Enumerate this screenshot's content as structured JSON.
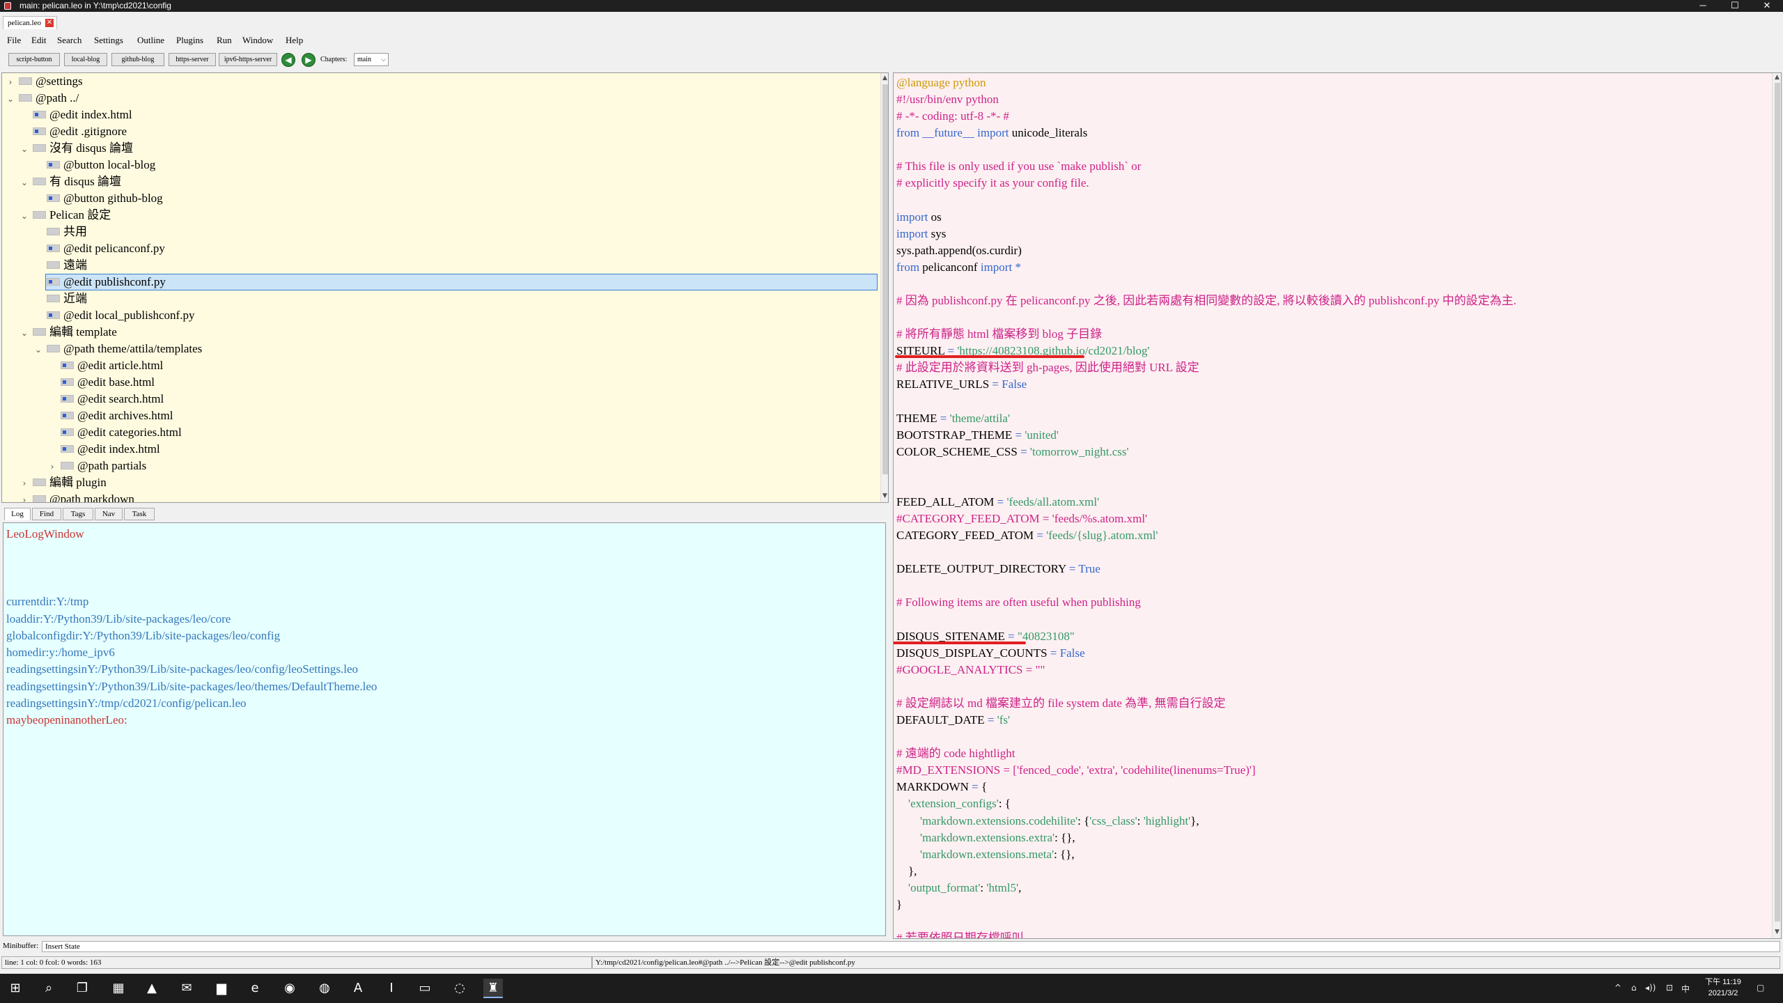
{
  "window": {
    "title": "main: pelican.leo in Y:\\tmp\\cd2021\\config",
    "minimize": "─",
    "maximize": "☐",
    "close": "✕"
  },
  "tab": {
    "name": "pelican.leo",
    "close": "✕"
  },
  "menu": [
    "File",
    "Edit",
    "Search",
    "Settings",
    "Outline",
    "Plugins",
    "Run",
    "Window",
    "Help"
  ],
  "toolbar": {
    "buttons": [
      "script-button",
      "local-blog",
      "github-blog",
      "https-server",
      "ipv6-https-server"
    ],
    "back": "◀",
    "forward": "▶",
    "chapters_label": "Chapters:",
    "chapters_value": "main",
    "dropdown": "⌵"
  },
  "outline": {
    "nodes": [
      {
        "depth": 0,
        "twisty": "›",
        "icon": "plain",
        "label": "@settings"
      },
      {
        "depth": 0,
        "twisty": "⌄",
        "icon": "plain",
        "label": "@path ../"
      },
      {
        "depth": 1,
        "twisty": "",
        "icon": "body",
        "label": "@edit index.html"
      },
      {
        "depth": 1,
        "twisty": "",
        "icon": "body",
        "label": "@edit .gitignore"
      },
      {
        "depth": 1,
        "twisty": "⌄",
        "icon": "plain",
        "label": "沒有 disqus 論壇"
      },
      {
        "depth": 2,
        "twisty": "",
        "icon": "body",
        "label": "@button local-blog"
      },
      {
        "depth": 1,
        "twisty": "⌄",
        "icon": "plain",
        "label": "有 disqus 論壇"
      },
      {
        "depth": 2,
        "twisty": "",
        "icon": "body",
        "label": "@button github-blog"
      },
      {
        "depth": 1,
        "twisty": "⌄",
        "icon": "plain",
        "label": "Pelican 設定"
      },
      {
        "depth": 2,
        "twisty": "",
        "icon": "plain",
        "label": "共用"
      },
      {
        "depth": 2,
        "twisty": "",
        "icon": "body",
        "label": "@edit pelicanconf.py"
      },
      {
        "depth": 2,
        "twisty": "",
        "icon": "plain",
        "label": "遠端"
      },
      {
        "depth": 2,
        "twisty": "",
        "icon": "body",
        "label": "@edit publishconf.py"
      },
      {
        "depth": 2,
        "twisty": "",
        "icon": "plain",
        "label": "近端"
      },
      {
        "depth": 2,
        "twisty": "",
        "icon": "body",
        "label": "@edit local_publishconf.py"
      },
      {
        "depth": 1,
        "twisty": "⌄",
        "icon": "plain",
        "label": "編輯 template"
      },
      {
        "depth": 2,
        "twisty": "⌄",
        "icon": "plain",
        "label": "@path theme/attila/templates"
      },
      {
        "depth": 3,
        "twisty": "",
        "icon": "body",
        "label": "@edit article.html"
      },
      {
        "depth": 3,
        "twisty": "",
        "icon": "body",
        "label": "@edit base.html"
      },
      {
        "depth": 3,
        "twisty": "",
        "icon": "body",
        "label": "@edit search.html"
      },
      {
        "depth": 3,
        "twisty": "",
        "icon": "body",
        "label": "@edit archives.html"
      },
      {
        "depth": 3,
        "twisty": "",
        "icon": "body",
        "label": "@edit categories.html"
      },
      {
        "depth": 3,
        "twisty": "",
        "icon": "body",
        "label": "@edit index.html"
      },
      {
        "depth": 3,
        "twisty": "›",
        "icon": "plain",
        "label": "@path partials"
      },
      {
        "depth": 1,
        "twisty": "›",
        "icon": "plain",
        "label": "編輯 plugin"
      },
      {
        "depth": 1,
        "twisty": "›",
        "icon": "plain",
        "label": "@path markdown"
      }
    ]
  },
  "log_tabs": [
    "Log",
    "Find",
    "Tags",
    "Nav",
    "Task"
  ],
  "log": [
    {
      "row": 0,
      "text": "LeoLogWindow",
      "color": "#cc3333"
    },
    {
      "row": 4,
      "text": "currentdir:Y:/tmp",
      "color": "#3377bb"
    },
    {
      "row": 5,
      "text": "loaddir:Y:/Python39/Lib/site-packages/leo/core",
      "color": "#3377bb"
    },
    {
      "row": 6,
      "text": "globalconfigdir:Y:/Python39/Lib/site-packages/leo/config",
      "color": "#3377bb"
    },
    {
      "row": 7,
      "text": "homedir:y:/home_ipv6",
      "color": "#3377bb"
    },
    {
      "row": 8,
      "text": "readingsettingsinY:/Python39/Lib/site-packages/leo/config/leoSettings.leo",
      "color": "#3377bb"
    },
    {
      "row": 9,
      "text": "readingsettingsinY:/Python39/Lib/site-packages/leo/themes/DefaultTheme.leo",
      "color": "#3377bb"
    },
    {
      "row": 10,
      "text": "readingsettingsinY:/tmp/cd2021/config/pelican.leo",
      "color": "#3377bb"
    },
    {
      "row": 11,
      "text": "maybeopeninanotherLeo:",
      "color": "#cc3333"
    }
  ],
  "body": [
    [
      [
        "dir",
        "@language python"
      ]
    ],
    [
      [
        "cm",
        "#!/usr/bin/env python"
      ]
    ],
    [
      [
        "cm",
        "# -*- coding: utf-8 -*- #"
      ]
    ],
    [
      [
        "kw",
        "from"
      ],
      [
        "kw",
        " __future__ "
      ],
      [
        "kw",
        "import"
      ],
      [
        "tx",
        " unicode_literals"
      ]
    ],
    [],
    [
      [
        "cm",
        "# This file is only used if you use `make publish` or"
      ]
    ],
    [
      [
        "cm",
        "# explicitly specify it as your config file."
      ]
    ],
    [],
    [
      [
        "kw",
        "import"
      ],
      [
        "tx",
        " os"
      ]
    ],
    [
      [
        "kw",
        "import"
      ],
      [
        "tx",
        " sys"
      ]
    ],
    [
      [
        "tx",
        "sys.path.append(os.curdir)"
      ]
    ],
    [
      [
        "kw",
        "from"
      ],
      [
        "tx",
        " pelicanconf "
      ],
      [
        "kw",
        "import"
      ],
      [
        "kw",
        " *"
      ]
    ],
    [],
    [
      [
        "cm",
        "# 因為 publishconf.py 在 pelicanconf.py 之後, 因此若兩處有相同變數的設定, 將以較後讀入的 publishconf.py 中的設定為主."
      ]
    ],
    [],
    [
      [
        "cm",
        "# 將所有靜態 html 檔案移到 blog 子目錄"
      ]
    ],
    [
      [
        "tx",
        "SITEURL"
      ],
      [
        "kw",
        " = "
      ],
      [
        "st",
        "'https://40823108.github.io/cd2021/blog'"
      ]
    ],
    [
      [
        "cm",
        "# 此設定用於將資料送到 gh-pages, 因此使用絕對 URL 設定"
      ]
    ],
    [
      [
        "tx",
        "RELATIVE_URLS"
      ],
      [
        "kw",
        " = False"
      ]
    ],
    [],
    [
      [
        "tx",
        "THEME"
      ],
      [
        "kw",
        " = "
      ],
      [
        "st",
        "'theme/attila'"
      ]
    ],
    [
      [
        "tx",
        "BOOTSTRAP_THEME"
      ],
      [
        "kw",
        " = "
      ],
      [
        "st",
        "'united'"
      ]
    ],
    [
      [
        "tx",
        "COLOR_SCHEME_CSS"
      ],
      [
        "kw",
        " = "
      ],
      [
        "st",
        "'tomorrow_night.css'"
      ]
    ],
    [],
    [],
    [
      [
        "tx",
        "FEED_ALL_ATOM"
      ],
      [
        "kw",
        " = "
      ],
      [
        "st",
        "'feeds/all.atom.xml'"
      ]
    ],
    [
      [
        "cm",
        "#CATEGORY_FEED_ATOM = 'feeds/%s.atom.xml'"
      ]
    ],
    [
      [
        "tx",
        "CATEGORY_FEED_ATOM"
      ],
      [
        "kw",
        " = "
      ],
      [
        "st",
        "'feeds/{slug}.atom.xml'"
      ]
    ],
    [],
    [
      [
        "tx",
        "DELETE_OUTPUT_DIRECTORY"
      ],
      [
        "kw",
        " = True"
      ]
    ],
    [],
    [
      [
        "cm",
        "# Following items are often useful when publishing"
      ]
    ],
    [],
    [
      [
        "tx",
        "DISQUS_SITENAME"
      ],
      [
        "kw",
        " = "
      ],
      [
        "st",
        "\"40823108\""
      ]
    ],
    [
      [
        "tx",
        "DISQUS_DISPLAY_COUNTS"
      ],
      [
        "kw",
        " = False"
      ]
    ],
    [
      [
        "cm",
        "#GOOGLE_ANALYTICS = \"\""
      ]
    ],
    [],
    [
      [
        "cm",
        "# 設定網誌以 md 檔案建立的 file system date 為準, 無需自行設定"
      ]
    ],
    [
      [
        "tx",
        "DEFAULT_DATE"
      ],
      [
        "kw",
        " = "
      ],
      [
        "st",
        "'fs'"
      ]
    ],
    [],
    [
      [
        "cm",
        "# 遠端的 code hightlight"
      ]
    ],
    [
      [
        "cm",
        "#MD_EXTENSIONS = ['fenced_code', 'extra', 'codehilite(linenums=True)']"
      ]
    ],
    [
      [
        "tx",
        "MARKDOWN"
      ],
      [
        "kw",
        " = "
      ],
      [
        "tx",
        "{"
      ]
    ],
    [
      [
        "st",
        "    'extension_configs'"
      ],
      [
        "tx",
        ": {"
      ]
    ],
    [
      [
        "st",
        "        'markdown.extensions.codehilite'"
      ],
      [
        "tx",
        ": {"
      ],
      [
        "st",
        "'css_class'"
      ],
      [
        "tx",
        ": "
      ],
      [
        "st",
        "'highlight'"
      ],
      [
        "tx",
        "},"
      ]
    ],
    [
      [
        "st",
        "        'markdown.extensions.extra'"
      ],
      [
        "tx",
        ": {},"
      ]
    ],
    [
      [
        "st",
        "        'markdown.extensions.meta'"
      ],
      [
        "tx",
        ": {},"
      ]
    ],
    [
      [
        "tx",
        "    },"
      ]
    ],
    [
      [
        "st",
        "    'output_format'"
      ],
      [
        "tx",
        ": "
      ],
      [
        "st",
        "'html5'"
      ],
      [
        "tx",
        ","
      ]
    ],
    [
      [
        "tx",
        "}"
      ]
    ],
    [],
    [
      [
        "cm",
        "# 若要依照日期存檔呼叫"
      ]
    ]
  ],
  "minibuffer": {
    "label": "Minibuffer:",
    "value": "Insert State"
  },
  "status": {
    "left": "line: 1 col: 0 fcol: 0 words: 163",
    "right": "Y:/tmp/cd2021/config/pelican.leo#@path ../-->Pelican 設定-->@edit publishconf.py"
  },
  "taskbar": {
    "start": "⊞",
    "search": "⌕",
    "taskview": "❐",
    "apps": [
      "▦",
      "▲",
      "✉",
      "▆",
      "e",
      "◉",
      "◍",
      "A",
      "I",
      "▭",
      "◌",
      "♜"
    ],
    "tray": [
      "^",
      "⌂",
      "◂))",
      "⊡",
      "中"
    ],
    "time": "下午 11:19",
    "date": "2021/3/2",
    "notification": "▢"
  }
}
